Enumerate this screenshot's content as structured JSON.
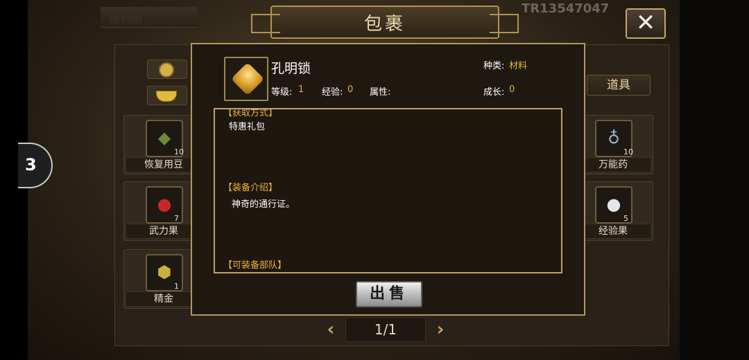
{
  "header": {
    "title": "包裹",
    "bg_tab_label": "福利团",
    "server_code": "TR13547047",
    "close_label": "✕"
  },
  "tabs": {
    "active_tab": "道具"
  },
  "inventory": {
    "slots": [
      {
        "name": "恢复用豆",
        "count": "10",
        "icon": "bean-bag-icon"
      },
      {
        "name": "万能药",
        "count": "10",
        "icon": "potion-bottle-icon"
      },
      {
        "name": "武力果",
        "count": "7",
        "icon": "red-berries-icon"
      },
      {
        "name": "经验果",
        "count": "5",
        "icon": "white-fruit-icon"
      },
      {
        "name": "精金",
        "count": "1",
        "icon": "gold-ore-icon"
      }
    ]
  },
  "pagination": {
    "page": "1/1"
  },
  "popup": {
    "item_name": "孔明锁",
    "category_label": "种类:",
    "category_value": "材料",
    "level_label": "等级:",
    "level_value": "1",
    "exp_label": "经验:",
    "exp_value": "0",
    "attr_label": "属性:",
    "growth_label": "成长:",
    "growth_value": "0",
    "sections": {
      "obtain_title": "【获取方式】",
      "obtain_text": "特惠礼包",
      "intro_title": "【装备介绍】",
      "intro_text": "神奇的通行证。",
      "equip_title": "【可装备部队】"
    },
    "sell_label": "出售"
  },
  "colors": {
    "accent_gold": "#e0b640",
    "section_orange": "#f0b23a",
    "frame_gold": "#bda36a"
  }
}
